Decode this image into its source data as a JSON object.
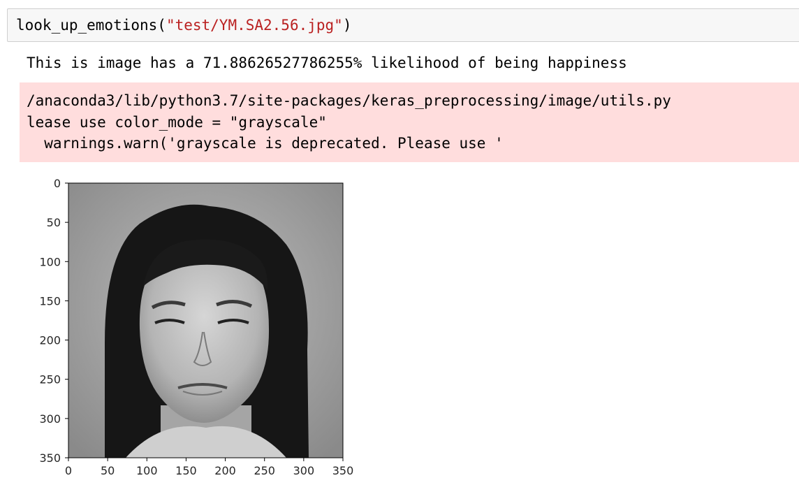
{
  "cell": {
    "code_fn": "look_up_emotions(",
    "code_arg": "\"test/YM.SA2.56.jpg\"",
    "code_close": ")"
  },
  "output": {
    "stdout": "This is image has a 71.88626527786255% likelihood of being happiness",
    "stderr_lines": [
      "/anaconda3/lib/python3.7/site-packages/keras_preprocessing/image/utils.py",
      "lease use color_mode = \"grayscale\"",
      "  warnings.warn('grayscale is deprecated. Please use '"
    ]
  },
  "chart_data": {
    "type": "image",
    "x_ticks": [
      "0",
      "50",
      "100",
      "150",
      "200",
      "250",
      "300",
      "350"
    ],
    "y_ticks": [
      "0",
      "50",
      "100",
      "150",
      "200",
      "250",
      "300",
      "350"
    ],
    "xlim": [
      0,
      350
    ],
    "ylim": [
      350,
      0
    ],
    "grid": false,
    "image_description": "grayscale portrait photo"
  },
  "colors": {
    "code_bg": "#f7f7f7",
    "string": "#ba2121",
    "stderr_bg": "#ffdddd"
  }
}
